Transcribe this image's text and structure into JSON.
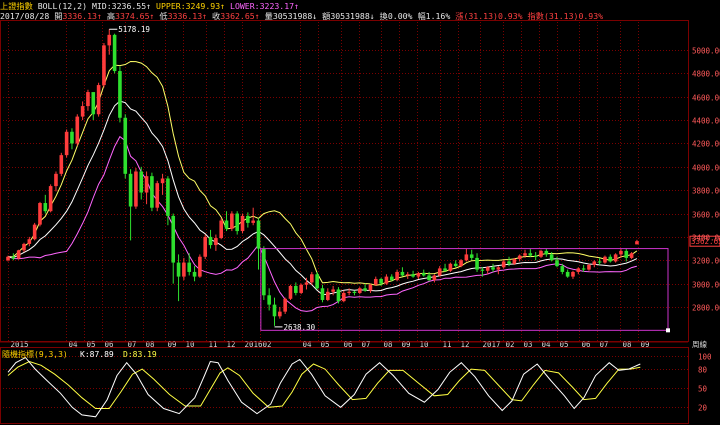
{
  "header": {
    "index_name": "上證指數",
    "boll_label": "BOLL(12,2)",
    "mid_label": "MID:",
    "mid_value": "3236.55",
    "upper_label": "UPPER:",
    "upper_value": "3249.93",
    "lower_label": "LOWER:",
    "lower_value": "3223.17",
    "date": "2017/08/28",
    "open_label": "開",
    "open_value": "3336.13",
    "high_label": "高",
    "high_value": "3374.65",
    "low_label": "低",
    "low_value": "3336.13",
    "close_label": "收",
    "close_value": "3362.65",
    "volume_label": "量",
    "volume_value": "30531988",
    "amount_label": "額",
    "amount_value": "30531988",
    "turnover_label": "換",
    "turnover_value": "0.00%",
    "amplitude_label": "幅",
    "amplitude_value": "1.16%",
    "change_label": "漲",
    "change_value": "(31.13)",
    "change_pct": "0.93%",
    "index_label": "指數",
    "index_change": "(31.13)",
    "index_pct": "0.93%"
  },
  "colors": {
    "up": "#ff3c3c",
    "down": "#2ee02e",
    "mid_line": "#ffffff",
    "upper_line": "#ffff66",
    "lower_line": "#ff66ff",
    "stoch_k": "#ffffff",
    "stoch_d": "#ffff44",
    "grid": "#7a0000",
    "box": "#cc33cc"
  },
  "chart_data": [
    {
      "type": "line",
      "subtype": "candlestick-weekly",
      "title": "上證指數 BOLL(12,2)",
      "y_ticks": [
        2800,
        3000,
        3200,
        3400,
        3600,
        3800,
        4000,
        4200,
        4400,
        4600,
        4800,
        5000
      ],
      "ylim": [
        2560,
        5240
      ],
      "x_ticks": [
        "2015",
        "04",
        "05",
        "06",
        "07",
        "08",
        "09",
        "10",
        "11",
        "12",
        "2016",
        "02",
        "04",
        "05",
        "06",
        "07",
        "08",
        "09",
        "10",
        "11",
        "12",
        "2017",
        "02",
        "03",
        "04",
        "05",
        "06",
        "07",
        "08",
        "09"
      ],
      "x_axis_unit": "周線",
      "annotations": {
        "high_label": "5178.19",
        "low_label": "2638.30",
        "last_price_label": "3362.65"
      },
      "ohlc": [
        [
          3200,
          3240,
          3190,
          3230
        ],
        [
          3230,
          3260,
          3200,
          3215
        ],
        [
          3215,
          3290,
          3205,
          3285
        ],
        [
          3285,
          3350,
          3270,
          3340
        ],
        [
          3340,
          3400,
          3320,
          3380
        ],
        [
          3380,
          3520,
          3370,
          3505
        ],
        [
          3505,
          3700,
          3490,
          3690
        ],
        [
          3690,
          3760,
          3600,
          3620
        ],
        [
          3620,
          3850,
          3610,
          3835
        ],
        [
          3835,
          3960,
          3790,
          3940
        ],
        [
          3940,
          4120,
          3920,
          4100
        ],
        [
          4100,
          4320,
          4080,
          4300
        ],
        [
          4300,
          4330,
          4150,
          4200
        ],
        [
          4200,
          4450,
          4180,
          4430
        ],
        [
          4430,
          4560,
          4400,
          4520
        ],
        [
          4520,
          4660,
          4480,
          4640
        ],
        [
          4640,
          4620,
          4400,
          4450
        ],
        [
          4450,
          4720,
          4430,
          4700
        ],
        [
          4700,
          5060,
          4680,
          5040
        ],
        [
          5040,
          5178,
          4960,
          5130
        ],
        [
          5130,
          5140,
          4800,
          4820
        ],
        [
          4820,
          4860,
          4380,
          4420
        ],
        [
          4420,
          4450,
          3900,
          3940
        ],
        [
          3940,
          3980,
          3370,
          3660
        ],
        [
          3660,
          3990,
          3640,
          3960
        ],
        [
          3960,
          4000,
          3720,
          3780
        ],
        [
          3780,
          3960,
          3680,
          3920
        ],
        [
          3920,
          3950,
          3620,
          3650
        ],
        [
          3650,
          3880,
          3620,
          3860
        ],
        [
          3860,
          3940,
          3760,
          3900
        ],
        [
          3900,
          3920,
          3500,
          3580
        ],
        [
          3580,
          3600,
          3000,
          3180
        ],
        [
          3180,
          3250,
          2850,
          3060
        ],
        [
          3060,
          3220,
          3030,
          3180
        ],
        [
          3180,
          3260,
          3070,
          3100
        ],
        [
          3100,
          3150,
          3020,
          3060
        ],
        [
          3060,
          3250,
          3050,
          3230
        ],
        [
          3230,
          3420,
          3210,
          3400
        ],
        [
          3400,
          3460,
          3300,
          3330
        ],
        [
          3330,
          3420,
          3280,
          3390
        ],
        [
          3390,
          3560,
          3380,
          3540
        ],
        [
          3540,
          3620,
          3450,
          3470
        ],
        [
          3470,
          3620,
          3450,
          3600
        ],
        [
          3600,
          3620,
          3420,
          3450
        ],
        [
          3450,
          3600,
          3430,
          3580
        ],
        [
          3580,
          3610,
          3480,
          3520
        ],
        [
          3520,
          3650,
          3500,
          3540
        ],
        [
          3540,
          3560,
          3120,
          3300
        ],
        [
          3300,
          3320,
          2860,
          2900
        ],
        [
          2900,
          2960,
          2770,
          2820
        ],
        [
          2820,
          2880,
          2638,
          2720
        ],
        [
          2720,
          2800,
          2700,
          2760
        ],
        [
          2760,
          2880,
          2740,
          2870
        ],
        [
          2870,
          2990,
          2860,
          2980
        ],
        [
          2980,
          3010,
          2900,
          2920
        ],
        [
          2920,
          3000,
          2910,
          2990
        ],
        [
          2990,
          3050,
          2950,
          3010
        ],
        [
          3010,
          3100,
          2990,
          3080
        ],
        [
          3080,
          3100,
          2950,
          2960
        ],
        [
          2960,
          2990,
          2840,
          2860
        ],
        [
          2860,
          2960,
          2850,
          2930
        ],
        [
          2930,
          2980,
          2900,
          2950
        ],
        [
          2950,
          2970,
          2830,
          2850
        ],
        [
          2850,
          2940,
          2840,
          2920
        ],
        [
          2920,
          2960,
          2900,
          2930
        ],
        [
          2930,
          2940,
          2900,
          2920
        ],
        [
          2920,
          2970,
          2910,
          2960
        ],
        [
          2960,
          3000,
          2930,
          2940
        ],
        [
          2940,
          3000,
          2920,
          2990
        ],
        [
          2990,
          3060,
          2980,
          3040
        ],
        [
          3040,
          3050,
          2980,
          3000
        ],
        [
          3000,
          3080,
          2990,
          3060
        ],
        [
          3060,
          3080,
          3020,
          3030
        ],
        [
          3030,
          3120,
          3020,
          3100
        ],
        [
          3100,
          3140,
          3060,
          3070
        ],
        [
          3070,
          3100,
          3040,
          3080
        ],
        [
          3080,
          3110,
          3050,
          3060
        ],
        [
          3060,
          3100,
          3040,
          3090
        ],
        [
          3090,
          3120,
          3060,
          3070
        ],
        [
          3070,
          3100,
          3020,
          3030
        ],
        [
          3030,
          3080,
          3010,
          3070
        ],
        [
          3070,
          3150,
          3060,
          3130
        ],
        [
          3130,
          3170,
          3100,
          3110
        ],
        [
          3110,
          3180,
          3100,
          3170
        ],
        [
          3170,
          3200,
          3140,
          3150
        ],
        [
          3150,
          3210,
          3140,
          3200
        ],
        [
          3200,
          3300,
          3190,
          3250
        ],
        [
          3250,
          3290,
          3200,
          3220
        ],
        [
          3220,
          3260,
          3100,
          3120
        ],
        [
          3120,
          3140,
          3060,
          3110
        ],
        [
          3110,
          3150,
          3080,
          3140
        ],
        [
          3140,
          3170,
          3100,
          3120
        ],
        [
          3120,
          3150,
          3080,
          3140
        ],
        [
          3140,
          3200,
          3130,
          3190
        ],
        [
          3190,
          3230,
          3150,
          3170
        ],
        [
          3170,
          3220,
          3160,
          3210
        ],
        [
          3210,
          3250,
          3190,
          3240
        ],
        [
          3240,
          3290,
          3220,
          3260
        ],
        [
          3260,
          3300,
          3230,
          3240
        ],
        [
          3240,
          3270,
          3200,
          3230
        ],
        [
          3230,
          3290,
          3220,
          3280
        ],
        [
          3280,
          3300,
          3230,
          3250
        ],
        [
          3250,
          3270,
          3190,
          3200
        ],
        [
          3200,
          3230,
          3140,
          3150
        ],
        [
          3150,
          3170,
          3080,
          3100
        ],
        [
          3100,
          3120,
          3050,
          3060
        ],
        [
          3060,
          3110,
          3040,
          3100
        ],
        [
          3100,
          3140,
          3080,
          3130
        ],
        [
          3130,
          3160,
          3100,
          3120
        ],
        [
          3120,
          3170,
          3110,
          3160
        ],
        [
          3160,
          3200,
          3140,
          3190
        ],
        [
          3190,
          3220,
          3160,
          3180
        ],
        [
          3180,
          3240,
          3170,
          3230
        ],
        [
          3230,
          3250,
          3180,
          3190
        ],
        [
          3190,
          3260,
          3180,
          3250
        ],
        [
          3250,
          3300,
          3220,
          3280
        ],
        [
          3280,
          3300,
          3190,
          3220
        ],
        [
          3220,
          3270,
          3210,
          3260
        ],
        [
          3336,
          3375,
          3336,
          3363
        ]
      ]
    },
    {
      "type": "line",
      "title": "隨機指標(9,3,3)",
      "series_labels": {
        "k": "K:87.89",
        "d": "D:83.19"
      },
      "y_ticks": [
        20,
        50,
        80,
        100
      ],
      "ylim": [
        0,
        110
      ],
      "k_points": [
        [
          0,
          75
        ],
        [
          4,
          90
        ],
        [
          9,
          98
        ],
        [
          14,
          80
        ],
        [
          20,
          62
        ],
        [
          27,
          42
        ],
        [
          33,
          20
        ],
        [
          38,
          8
        ],
        [
          45,
          5
        ],
        [
          51,
          32
        ],
        [
          56,
          70
        ],
        [
          61,
          90
        ],
        [
          66,
          72
        ],
        [
          72,
          40
        ],
        [
          80,
          18
        ],
        [
          88,
          10
        ],
        [
          96,
          35
        ],
        [
          101,
          70
        ],
        [
          104,
          92
        ],
        [
          108,
          90
        ],
        [
          113,
          62
        ],
        [
          120,
          28
        ],
        [
          128,
          10
        ],
        [
          135,
          25
        ],
        [
          140,
          58
        ],
        [
          146,
          88
        ],
        [
          150,
          95
        ],
        [
          156,
          72
        ],
        [
          163,
          38
        ],
        [
          171,
          20
        ],
        [
          178,
          40
        ],
        [
          184,
          72
        ],
        [
          191,
          90
        ],
        [
          198,
          70
        ],
        [
          206,
          42
        ],
        [
          214,
          28
        ],
        [
          221,
          48
        ],
        [
          227,
          75
        ],
        [
          233,
          90
        ],
        [
          240,
          68
        ],
        [
          247,
          38
        ],
        [
          254,
          15
        ],
        [
          259,
          30
        ],
        [
          265,
          72
        ],
        [
          272,
          88
        ],
        [
          279,
          62
        ],
        [
          286,
          38
        ],
        [
          291,
          18
        ],
        [
          296,
          35
        ],
        [
          302,
          70
        ],
        [
          309,
          90
        ],
        [
          314,
          78
        ],
        [
          319,
          80
        ],
        [
          325,
          88
        ]
      ],
      "d_points": [
        [
          0,
          70
        ],
        [
          5,
          83
        ],
        [
          11,
          92
        ],
        [
          17,
          86
        ],
        [
          24,
          72
        ],
        [
          31,
          55
        ],
        [
          38,
          35
        ],
        [
          45,
          18
        ],
        [
          52,
          18
        ],
        [
          58,
          44
        ],
        [
          64,
          72
        ],
        [
          69,
          80
        ],
        [
          75,
          64
        ],
        [
          83,
          40
        ],
        [
          91,
          22
        ],
        [
          99,
          22
        ],
        [
          104,
          48
        ],
        [
          109,
          74
        ],
        [
          113,
          82
        ],
        [
          119,
          70
        ],
        [
          126,
          42
        ],
        [
          134,
          20
        ],
        [
          141,
          22
        ],
        [
          146,
          44
        ],
        [
          151,
          72
        ],
        [
          157,
          88
        ],
        [
          163,
          80
        ],
        [
          170,
          55
        ],
        [
          177,
          32
        ],
        [
          184,
          34
        ],
        [
          190,
          58
        ],
        [
          196,
          78
        ],
        [
          203,
          78
        ],
        [
          211,
          58
        ],
        [
          219,
          38
        ],
        [
          226,
          40
        ],
        [
          232,
          62
        ],
        [
          238,
          80
        ],
        [
          245,
          78
        ],
        [
          252,
          55
        ],
        [
          259,
          32
        ],
        [
          264,
          30
        ],
        [
          270,
          55
        ],
        [
          276,
          78
        ],
        [
          283,
          74
        ],
        [
          290,
          52
        ],
        [
          296,
          32
        ],
        [
          302,
          34
        ],
        [
          308,
          58
        ],
        [
          314,
          80
        ],
        [
          320,
          80
        ],
        [
          325,
          83
        ]
      ]
    }
  ]
}
